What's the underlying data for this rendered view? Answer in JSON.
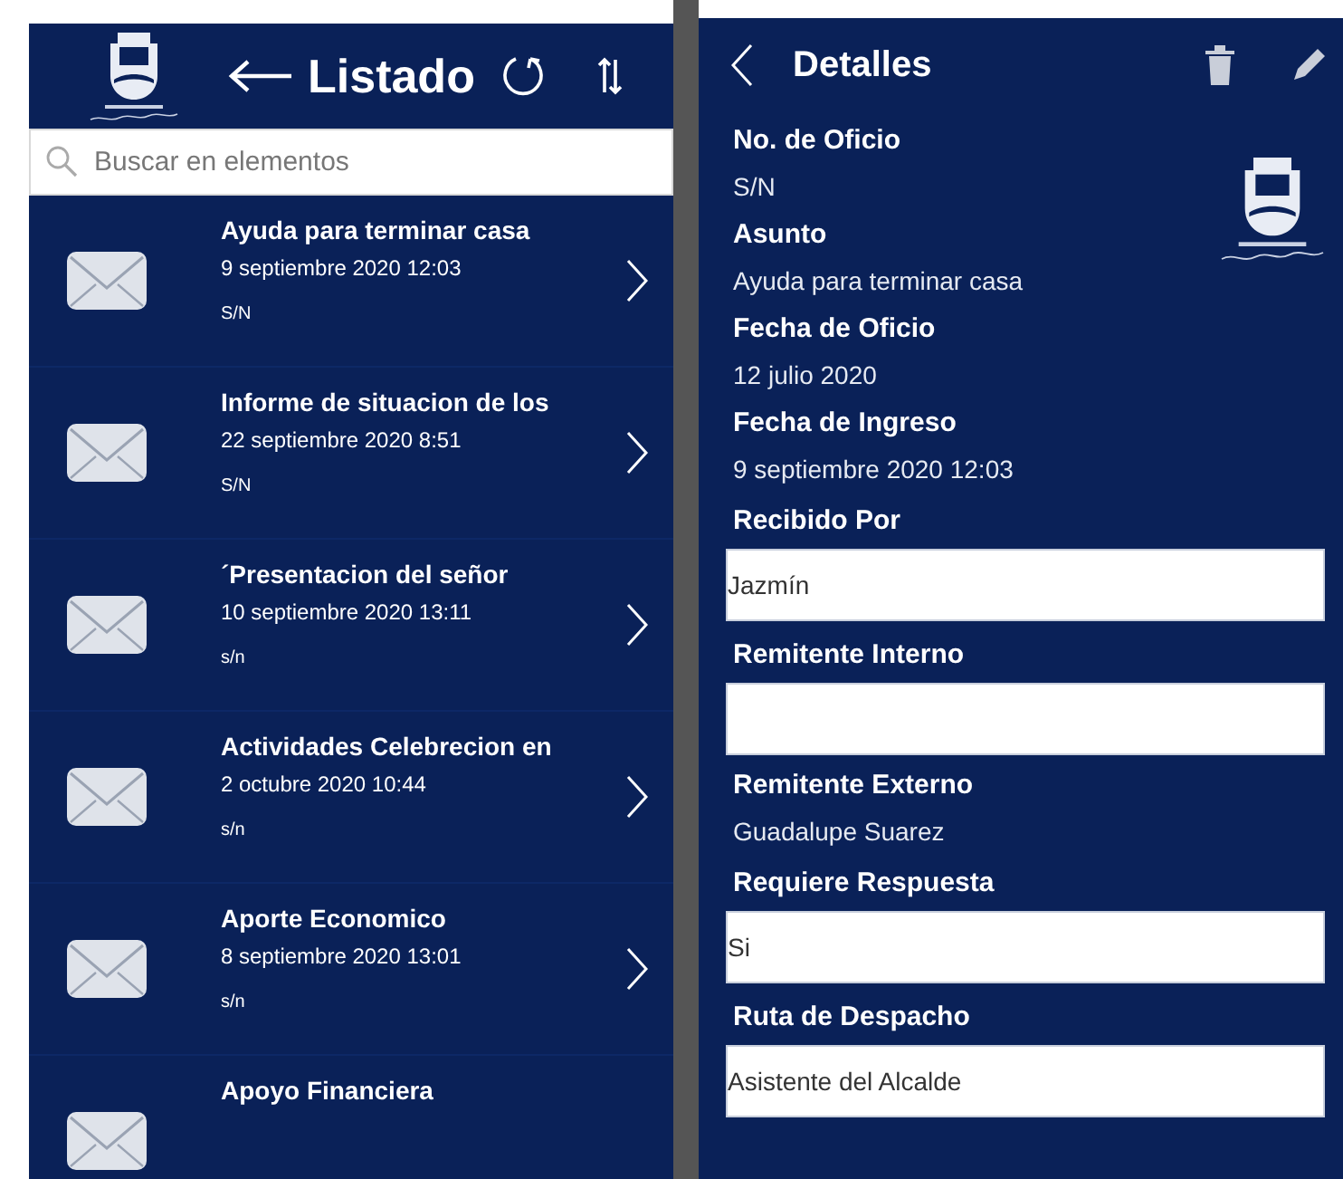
{
  "list_panel": {
    "title": "Listado",
    "search": {
      "placeholder": "Buscar en elementos"
    },
    "items": [
      {
        "title": "Ayuda para terminar casa",
        "date": "9 septiembre 2020 12:03",
        "reference": "S/N"
      },
      {
        "title": "Informe de situacion de los",
        "date": "22 septiembre 2020 8:51",
        "reference": "S/N"
      },
      {
        "title": "´Presentacion del señor",
        "date": "10 septiembre 2020 13:11",
        "reference": "s/n"
      },
      {
        "title": "Actividades Celebrecion en",
        "date": "2 octubre 2020 10:44",
        "reference": "s/n"
      },
      {
        "title": "Aporte Economico",
        "date": "8 septiembre 2020 13:01",
        "reference": "s/n"
      },
      {
        "title": "Apoyo Financiera"
      }
    ]
  },
  "detail_panel": {
    "title": "Detalles",
    "fields": [
      {
        "kind": "text",
        "label": "No. de Oficio",
        "value": "S/N"
      },
      {
        "kind": "text",
        "label": "Asunto",
        "value": "Ayuda para terminar casa"
      },
      {
        "kind": "text",
        "label": "Fecha de Oficio",
        "value": "12 julio 2020"
      },
      {
        "kind": "text",
        "label": "Fecha de Ingreso",
        "value": "9 septiembre 2020 12:03"
      },
      {
        "kind": "input",
        "label": "Recibido Por",
        "value": "Jazmín"
      },
      {
        "kind": "input",
        "label": "Remitente Interno"
      },
      {
        "kind": "text",
        "label": "Remitente Externo",
        "value": "Guadalupe Suarez"
      },
      {
        "kind": "input",
        "label": "Requiere Respuesta",
        "value": "Si"
      },
      {
        "kind": "input",
        "label": "Ruta de Despacho",
        "value": "Asistente del Alcalde"
      }
    ]
  }
}
